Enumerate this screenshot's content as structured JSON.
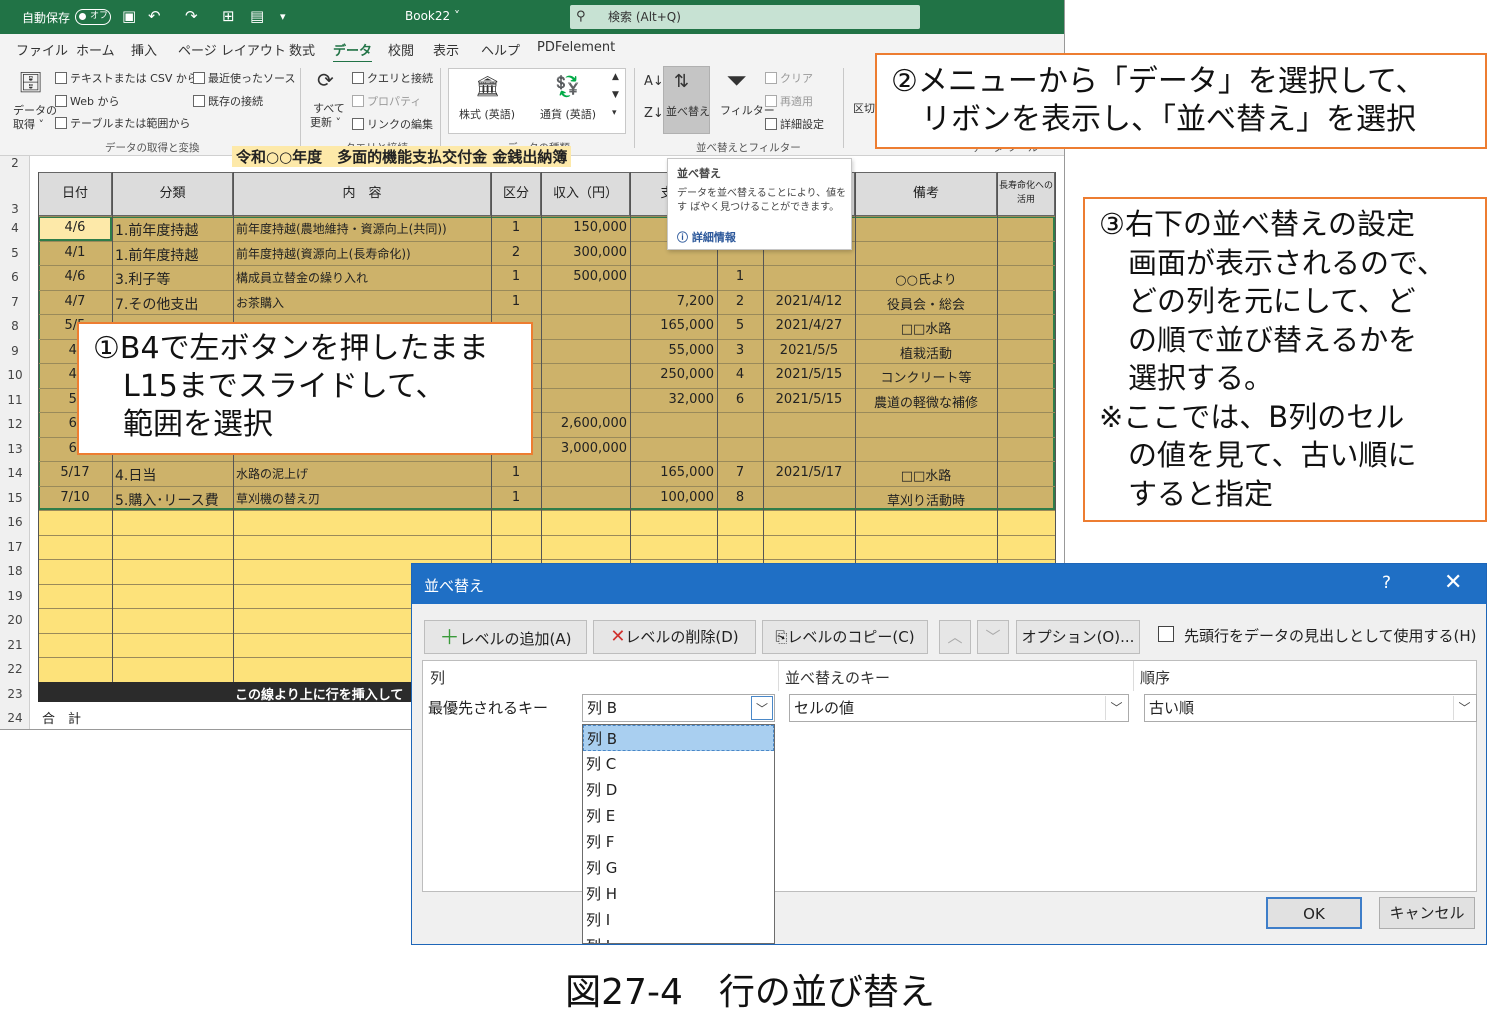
{
  "titlebar": {
    "autosave_label": "自動保存",
    "autosave_state": "オフ",
    "filename": "Book22 ˅",
    "search_placeholder": "検索 (Alt+Q)"
  },
  "menu": [
    "ファイル",
    "ホーム",
    "挿入",
    "ページ レイアウト",
    "数式",
    "データ",
    "校閲",
    "表示",
    "ヘルプ",
    "PDFelement"
  ],
  "menu_active": "データ",
  "ribbon": {
    "get_data_line1": "データの",
    "get_data_line2": "取得 ˅",
    "text_csv": "テキストまたは CSV から",
    "web": "Web から",
    "table_range": "テーブルまたは範囲から",
    "recent_sources": "最近使ったソース",
    "existing_connections": "既存の接続",
    "group_get_data": "データの取得と変換",
    "refresh_all_line1": "すべて",
    "refresh_all_line2": "更新 ˅",
    "queries_connections": "クエリと接続",
    "properties": "プロパティ",
    "edit_links": "リンクの編集",
    "group_queries": "クエリと接続",
    "stocks": "株式 (英語)",
    "currencies": "通貨 (英語)",
    "group_data_types": "データの種類",
    "sort": "並べ替え",
    "filter": "フィルター",
    "clear": "クリア",
    "reapply": "再適用",
    "advanced": "詳細設定",
    "group_sort_filter": "並べ替えとフィルター",
    "text_to_columns": "区切",
    "group_data_tools": "データ ツール"
  },
  "tooltip": {
    "title": "並べ替え",
    "desc": "データを並べ替えることにより、値をす ばやく見つけることができます。",
    "link": "詳細情報"
  },
  "sheet": {
    "title_row": "令和○○年度　多面的機能支払交付金 金銭出納簿",
    "headers": [
      "日付",
      "分類",
      "内　容",
      "区分",
      "収入（円）",
      "支出",
      "",
      "",
      "備考",
      "長寿命化への活用"
    ],
    "rows": [
      {
        "n": "4",
        "date": "4/6",
        "cat": "1.前年度持越",
        "content": "前年度持越(農地維持・資源向上(共同))",
        "kubun": "1",
        "income": "150,000",
        "expense": "",
        "no": "",
        "paid": "",
        "note": ""
      },
      {
        "n": "5",
        "date": "4/1",
        "cat": "1.前年度持越",
        "content": "前年度持越(資源向上(長寿命化))",
        "kubun": "2",
        "income": "300,000",
        "expense": "",
        "no": "",
        "paid": "",
        "note": ""
      },
      {
        "n": "6",
        "date": "4/6",
        "cat": "3.利子等",
        "content": "構成員立替金の繰り入れ",
        "kubun": "1",
        "income": "500,000",
        "expense": "",
        "no": "1",
        "paid": "",
        "note": "○○氏より"
      },
      {
        "n": "7",
        "date": "4/7",
        "cat": "7.その他支出",
        "content": "お茶購入",
        "kubun": "1",
        "income": "",
        "expense": "7,200",
        "no": "2",
        "paid": "2021/4/12",
        "note": "役員会・総会"
      },
      {
        "n": "8",
        "date": "5/5",
        "cat": "",
        "content": "",
        "kubun": "",
        "income": "",
        "expense": "165,000",
        "no": "5",
        "paid": "2021/4/27",
        "note": "□□水路"
      },
      {
        "n": "9",
        "date": "4/",
        "cat": "",
        "content": "",
        "kubun": "",
        "income": "",
        "expense": "55,000",
        "no": "3",
        "paid": "2021/5/5",
        "note": "植栽活動"
      },
      {
        "n": "10",
        "date": "4/",
        "cat": "",
        "content": "",
        "kubun": "",
        "income": "",
        "expense": "250,000",
        "no": "4",
        "paid": "2021/5/15",
        "note": "コンクリート等"
      },
      {
        "n": "11",
        "date": "5/",
        "cat": "",
        "content": "",
        "kubun": "",
        "income": "",
        "expense": "32,000",
        "no": "6",
        "paid": "2021/5/15",
        "note": "農道の軽微な補修"
      },
      {
        "n": "12",
        "date": "6/",
        "cat": "",
        "content": "",
        "kubun": "",
        "income": "2,600,000",
        "expense": "",
        "no": "",
        "paid": "",
        "note": ""
      },
      {
        "n": "13",
        "date": "6/",
        "cat": "",
        "content": "",
        "kubun": "",
        "income": "3,000,000",
        "expense": "",
        "no": "",
        "paid": "",
        "note": ""
      },
      {
        "n": "14",
        "date": "5/17",
        "cat": "4.日当",
        "content": "水路の泥上げ",
        "kubun": "1",
        "income": "",
        "expense": "165,000",
        "no": "7",
        "paid": "2021/5/17",
        "note": "□□水路"
      },
      {
        "n": "15",
        "date": "7/10",
        "cat": "5.購入･リース費",
        "content": "草刈機の替え刃",
        "kubun": "1",
        "income": "",
        "expense": "100,000",
        "no": "8",
        "paid": "",
        "note": "草刈り活動時"
      }
    ],
    "empty_rows": [
      "16",
      "17",
      "18",
      "19",
      "20",
      "21",
      "22"
    ],
    "row2": "2",
    "row3": "3",
    "row23": "23",
    "row24": "24",
    "insert_line": "この線より上に行を挿入して",
    "total": "合　計"
  },
  "callouts": {
    "c1": [
      "①B4で左ボタンを押したまま",
      "　L15までスライドして、",
      "　範囲を選択"
    ],
    "c2": [
      "②メニューから「データ」を選択して、",
      "　リボンを表示し、「並べ替え」を選択"
    ],
    "c3": [
      "③右下の並べ替えの設定",
      "　画面が表示されるので、",
      "　どの列を元にして、ど",
      "　の順で並び替えるかを",
      "　選択する。",
      "※ここでは、B列のセル",
      "　の値を見て、古い順に",
      "　すると指定"
    ]
  },
  "dialog": {
    "title": "並べ替え",
    "help": "?",
    "close": "✕",
    "add_level": "レベルの追加(A)",
    "delete_level": "レベルの削除(D)",
    "copy_level": "レベルのコピー(C)",
    "options": "オプション(O)...",
    "header_checkbox": "先頭行をデータの見出しとして使用する(H)",
    "col_header": "列",
    "key_header": "並べ替えのキー",
    "order_header": "順序",
    "priority_label": "最優先されるキー",
    "column_value": "列 B",
    "key_value": "セルの値",
    "order_value": "古い順",
    "options_list": [
      "列 B",
      "列 C",
      "列 D",
      "列 E",
      "列 F",
      "列 G",
      "列 H",
      "列 I",
      "列 J"
    ],
    "ok": "OK",
    "cancel": "キャンセル"
  },
  "caption": "図27-4　行の並び替え"
}
